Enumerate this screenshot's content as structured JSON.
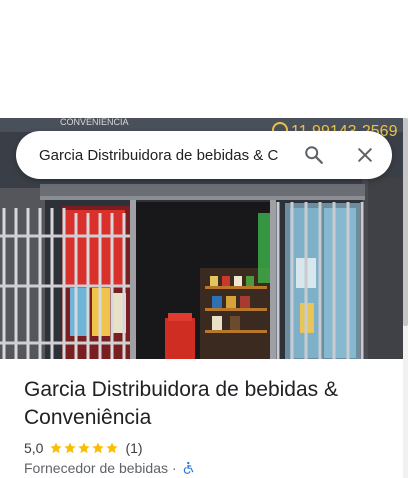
{
  "search": {
    "value": "Garcia Distribuidora de bebidas & C"
  },
  "photo": {
    "sign_text": "CONVENIÊNCIA",
    "phone_text": "11 99143-2569"
  },
  "place": {
    "title": "Garcia Distribuidora de bebidas & Conveniência",
    "rating": "5,0",
    "stars": 5,
    "review_count": "(1)",
    "category": "Fornecedor de bebidas",
    "separator": "·"
  },
  "colors": {
    "star": "#fbbc04",
    "accessibility": "#1a73e8",
    "text_primary": "#202124",
    "text_secondary": "#5f6368"
  },
  "icons": {
    "search": "search-icon",
    "close": "close-icon",
    "star": "star-icon",
    "accessibility": "wheelchair-icon"
  }
}
